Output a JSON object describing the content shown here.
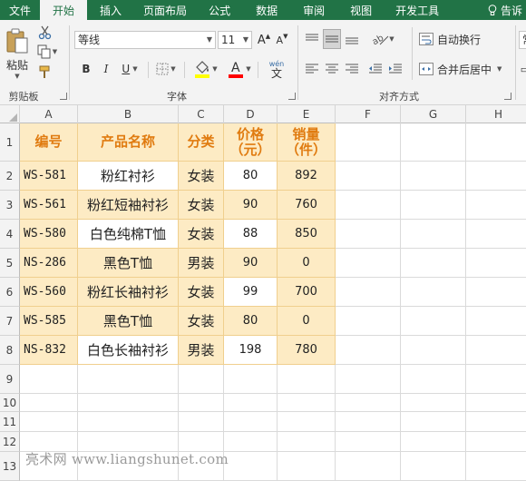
{
  "tabs": [
    "文件",
    "开始",
    "插入",
    "页面布局",
    "公式",
    "数据",
    "审阅",
    "视图",
    "开发工具"
  ],
  "active_tab": "开始",
  "tell_me": "告诉",
  "ribbon": {
    "clipboard": {
      "paste_label": "粘贴",
      "group_label": "剪贴板"
    },
    "font": {
      "font_name": "等线",
      "font_size": "11",
      "grow": "A",
      "shrink": "A",
      "bold": "B",
      "italic": "I",
      "underline": "U",
      "wen": "wén",
      "wen_char": "文",
      "group_label": "字体",
      "fill_color": "#ffff00",
      "font_color": "#ff0000"
    },
    "align": {
      "wrap_text": "自动换行",
      "merge_center": "合并后居中",
      "group_label": "对齐方式"
    },
    "number_partial": "常"
  },
  "columns": [
    "A",
    "B",
    "C",
    "D",
    "E",
    "F",
    "G",
    "H"
  ],
  "rows": [
    "1",
    "2",
    "3",
    "4",
    "5",
    "6",
    "7",
    "8",
    "9",
    "10",
    "11",
    "12",
    "13"
  ],
  "table": {
    "headers": [
      "编号",
      "产品名称",
      "分类",
      "价格\n（元）",
      "销量\n（件）"
    ],
    "rows": [
      [
        "WS-581",
        "粉红衬衫",
        "女装",
        "80",
        "892"
      ],
      [
        "WS-561",
        "粉红短袖衬衫",
        "女装",
        "90",
        "760"
      ],
      [
        "WS-580",
        "白色纯棉T恤",
        "女装",
        "88",
        "850"
      ],
      [
        "NS-286",
        "黑色T恤",
        "男装",
        "90",
        "0"
      ],
      [
        "WS-560",
        "粉红长袖衬衫",
        "女装",
        "99",
        "700"
      ],
      [
        "WS-585",
        "黑色T恤",
        "女装",
        "80",
        "0"
      ],
      [
        "NS-832",
        "白色长袖衬衫",
        "男装",
        "198",
        "780"
      ]
    ]
  },
  "colors": {
    "ribbon_green": "#217346",
    "header_text": "#e07b10",
    "cell_fill": "#fdebc4",
    "cell_border": "#f0cf8e"
  },
  "watermark": "亮术网 www.liangshunet.com"
}
